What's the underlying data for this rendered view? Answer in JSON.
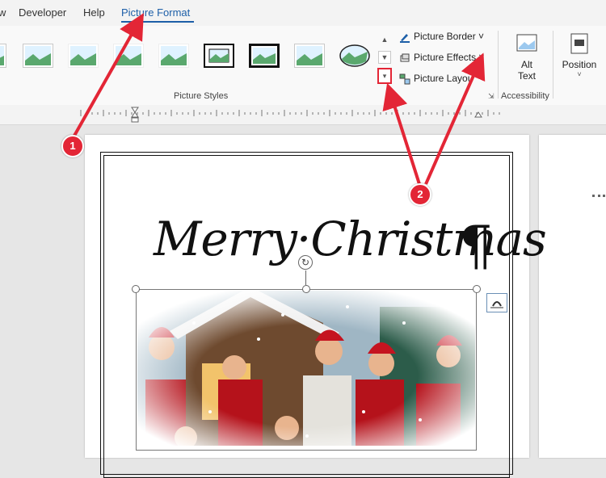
{
  "tabs": [
    {
      "label": "w"
    },
    {
      "label": "Developer"
    },
    {
      "label": "Help"
    },
    {
      "label": "Picture Format"
    }
  ],
  "ribbon": {
    "picture_styles_label": "Picture Styles",
    "picture_border": "Picture Border",
    "picture_effects": "Picture Effects",
    "picture_layout": "Picture Layout",
    "alt_text_line1": "Alt",
    "alt_text_line2": "Text",
    "accessibility_label": "Accessibility",
    "position_label": "Position"
  },
  "document": {
    "title": "Merry·Christmas",
    "pilcrow": "¶"
  },
  "callouts": {
    "one": "1",
    "two": "2"
  },
  "colors": {
    "accent": "#1d5fa8",
    "callout": "#e32636"
  }
}
